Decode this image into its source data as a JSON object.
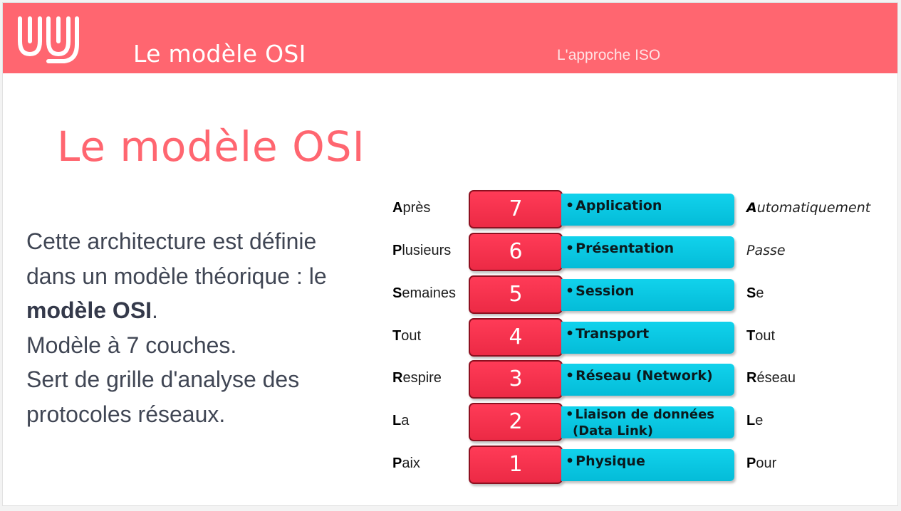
{
  "header": {
    "title": "Le modèle OSI",
    "subtitle": "L'approche ISO"
  },
  "main": {
    "title": "Le modèle OSI",
    "description": {
      "line1": "Cette architecture est définie",
      "line2": "dans un modèle théorique : le",
      "line3_bold": "modèle OSI",
      "line3_rest": ".",
      "line4": "Modèle à 7 couches.",
      "line5": "Sert de grille d'analyse des",
      "line6": "protocoles réseaux."
    }
  },
  "colors": {
    "accent": "#ff6670",
    "number_box": "#f0304c",
    "layer_box": "#08c6e0",
    "text": "#404654"
  },
  "layers": [
    {
      "number": "7",
      "bullet": "•",
      "name": "Application",
      "name2": "",
      "left_first": "A",
      "left_rest": "près",
      "right_first": "A",
      "right_rest": "utomatiquement",
      "right_italic": true
    },
    {
      "number": "6",
      "bullet": "•",
      "name": "Présentation",
      "name2": "",
      "left_first": "P",
      "left_rest": "lusieurs",
      "right_first": "",
      "right_rest": "Passe",
      "right_italic": true
    },
    {
      "number": "5",
      "bullet": "•",
      "name": "Session",
      "name2": "",
      "left_first": "S",
      "left_rest": "emaines",
      "right_first": "S",
      "right_rest": "e",
      "right_italic": false
    },
    {
      "number": "4",
      "bullet": "•",
      "name": "Transport",
      "name2": "",
      "left_first": "T",
      "left_rest": "out",
      "right_first": "T",
      "right_rest": "out",
      "right_italic": false
    },
    {
      "number": "3",
      "bullet": "•",
      "name": "Réseau (Network)",
      "name2": "",
      "left_first": "R",
      "left_rest": "espire",
      "right_first": "R",
      "right_rest": "éseau",
      "right_italic": false
    },
    {
      "number": "2",
      "bullet": "•",
      "name": "Liaison de données",
      "name2": "(Data Link)",
      "left_first": "L",
      "left_rest": "a",
      "right_first": "L",
      "right_rest": "e",
      "right_italic": false
    },
    {
      "number": "1",
      "bullet": "•",
      "name": "Physique",
      "name2": "",
      "left_first": "P",
      "left_rest": "aix",
      "right_first": "P",
      "right_rest": "our",
      "right_italic": false
    }
  ]
}
